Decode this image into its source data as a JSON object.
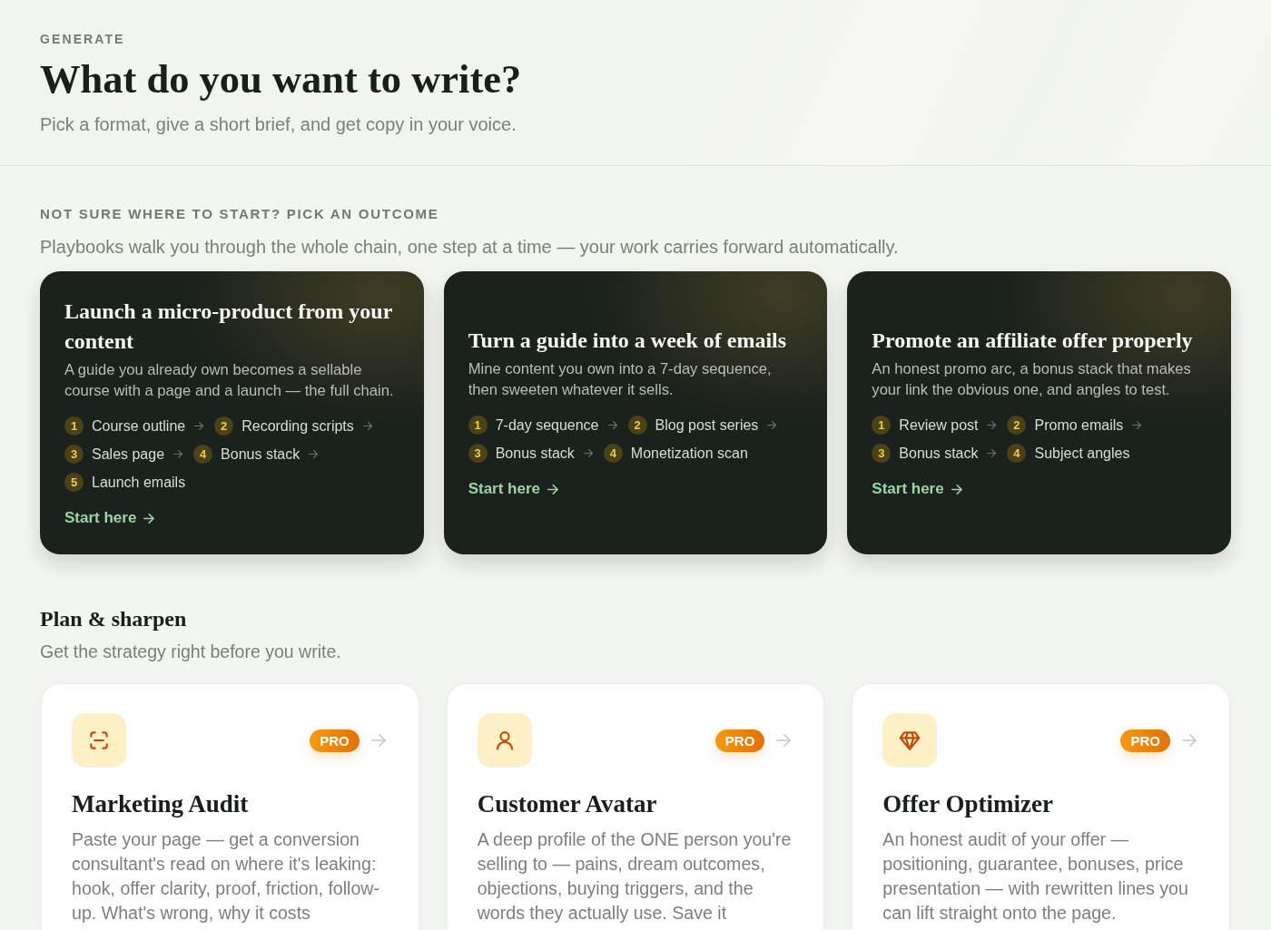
{
  "header": {
    "eyebrow": "GENERATE",
    "title": "What do you want to write?",
    "subtitle": "Pick a format, give a short brief, and get copy in your voice."
  },
  "playbooks": {
    "eyebrow": "NOT SURE WHERE TO START? PICK AN OUTCOME",
    "description": "Playbooks walk you through the whole chain, one step at a time — your work carries forward automatically.",
    "cards": [
      {
        "title": "Launch a micro-product from your content",
        "description": "A guide you already own becomes a sellable course with a page and a launch — the full chain.",
        "steps": [
          {
            "number": "1",
            "label": "Course outline"
          },
          {
            "number": "2",
            "label": "Recording scripts"
          },
          {
            "number": "3",
            "label": "Sales page"
          },
          {
            "number": "4",
            "label": "Bonus stack"
          },
          {
            "number": "5",
            "label": "Launch emails"
          }
        ],
        "cta": "Start here"
      },
      {
        "title": "Turn a guide into a week of emails",
        "description": "Mine content you own into a 7-day sequence, then sweeten whatever it sells.",
        "steps": [
          {
            "number": "1",
            "label": "7-day sequence"
          },
          {
            "number": "2",
            "label": "Blog post series"
          },
          {
            "number": "3",
            "label": "Bonus stack"
          },
          {
            "number": "4",
            "label": "Monetization scan"
          }
        ],
        "cta": "Start here"
      },
      {
        "title": "Promote an affiliate offer properly",
        "description": "An honest promo arc, a bonus stack that makes your link the obvious one, and angles to test.",
        "steps": [
          {
            "number": "1",
            "label": "Review post"
          },
          {
            "number": "2",
            "label": "Promo emails"
          },
          {
            "number": "3",
            "label": "Bonus stack"
          },
          {
            "number": "4",
            "label": "Subject angles"
          }
        ],
        "cta": "Start here"
      }
    ]
  },
  "plan": {
    "title": "Plan & sharpen",
    "subtitle": "Get the strategy right before you write.",
    "tools": [
      {
        "title": "Marketing Audit",
        "badge": "PRO",
        "description": "Paste your page — get a conversion consultant's read on where it's leaking: hook, offer clarity, proof, friction, follow-up. What's wrong, why it costs"
      },
      {
        "title": "Customer Avatar",
        "badge": "PRO",
        "description": "A deep profile of the ONE person you're selling to — pains, dream outcomes, objections, buying triggers, and the words they actually use. Save it"
      },
      {
        "title": "Offer Optimizer",
        "badge": "PRO",
        "description": "An honest audit of your offer — positioning, guarantee, bonuses, price presentation — with rewritten lines you can lift straight onto the page."
      }
    ]
  }
}
